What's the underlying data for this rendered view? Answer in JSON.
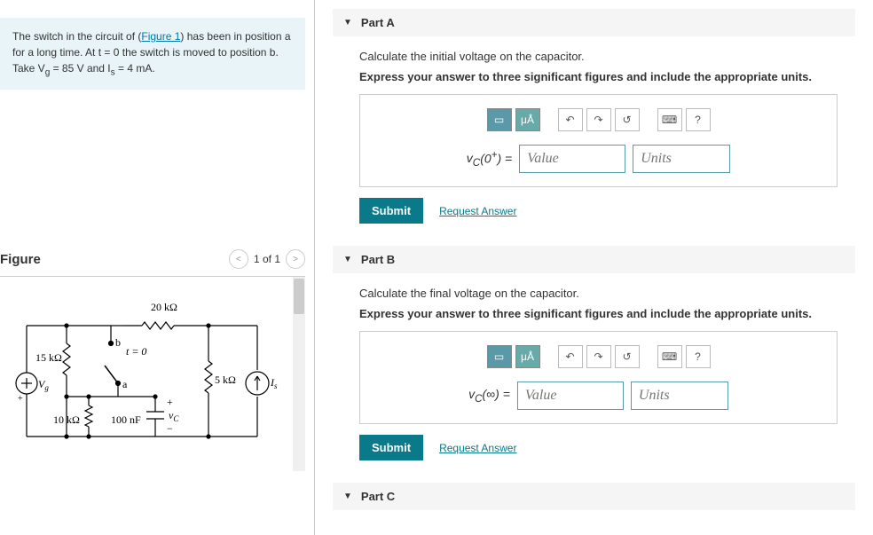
{
  "problem": {
    "text1": "The switch in the circuit of (",
    "figlink": "Figure 1",
    "text2": ") has been in position a for a long time. At t = 0 the switch is moved to position b. Take V",
    "text3": " = 85 V and I",
    "text4": " = 4 mA."
  },
  "figure": {
    "title": "Figure",
    "counter": "1 of 1"
  },
  "circuit": {
    "r1": "20 kΩ",
    "r2": "15 kΩ",
    "r3": "5 kΩ",
    "r4": "10 kΩ",
    "c1": "100 nF",
    "vg": "V",
    "vg_sub": "g",
    "is": "I",
    "is_sub": "s",
    "vc": "v",
    "vc_sub": "C",
    "sw_a": "a",
    "sw_b": "b",
    "sw_t": "t = 0",
    "plus": "+",
    "minus": "−"
  },
  "partA": {
    "title": "Part A",
    "question": "Calculate the initial voltage on the capacitor.",
    "instruction": "Express your answer to three significant figures and include the appropriate units.",
    "label": "vC(0⁺) =",
    "value_ph": "Value",
    "units_ph": "Units",
    "ua": "μÅ",
    "help": "?",
    "submit": "Submit",
    "request": "Request Answer"
  },
  "partB": {
    "title": "Part B",
    "question": "Calculate the final voltage on the capacitor.",
    "instruction": "Express your answer to three significant figures and include the appropriate units.",
    "label": "vC(∞) =",
    "value_ph": "Value",
    "units_ph": "Units",
    "ua": "μÅ",
    "help": "?",
    "submit": "Submit",
    "request": "Request Answer"
  },
  "partC": {
    "title": "Part C"
  }
}
